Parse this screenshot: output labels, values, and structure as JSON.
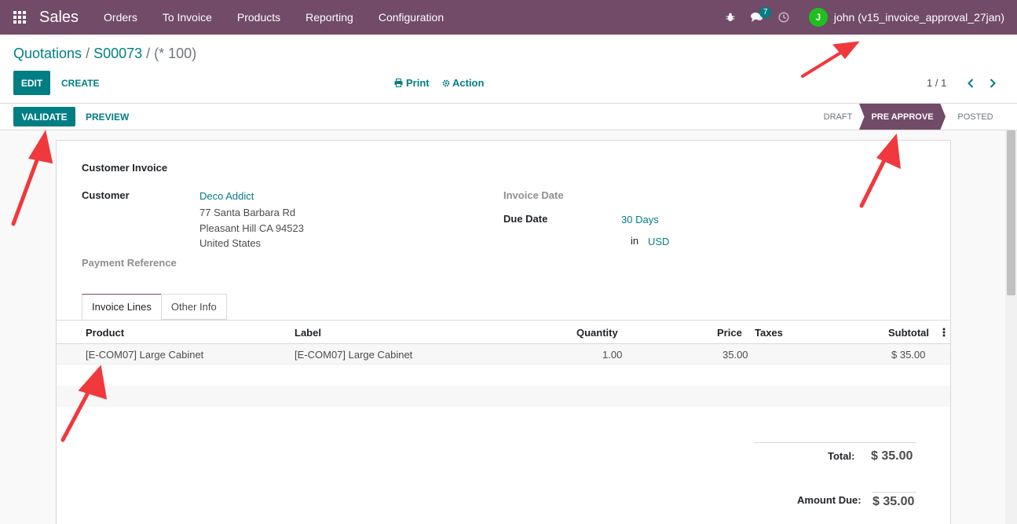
{
  "navbar": {
    "app_name": "Sales",
    "menu": [
      "Orders",
      "To Invoice",
      "Products",
      "Reporting",
      "Configuration"
    ],
    "messages_count": "7",
    "user_initial": "J",
    "user_name": "john (v15_invoice_approval_27jan)",
    "colors": {
      "bar": "#714b67",
      "avatar": "#1fbf1f"
    }
  },
  "breadcrumb": {
    "first": "Quotations",
    "sep1": " / ",
    "second": "S00073",
    "sep2": " / ",
    "current": "(* 100)"
  },
  "toolbar": {
    "edit_label": "EDIT",
    "create_label": "CREATE",
    "print_label": "Print",
    "action_label": "Action",
    "pager": "1 / 1"
  },
  "statusbar": {
    "validate_label": "VALIDATE",
    "preview_label": "PREVIEW",
    "stages": [
      "DRAFT",
      "PRE APPROVE",
      "POSTED"
    ],
    "active_stage": "PRE APPROVE"
  },
  "form": {
    "title": "Customer Invoice",
    "customer_label": "Customer",
    "customer_name": "Deco Addict",
    "address_line1": "77 Santa Barbara Rd",
    "address_line2": "Pleasant Hill CA 94523",
    "address_line3": "United States",
    "payment_reference_label": "Payment Reference",
    "invoice_date_label": "Invoice Date",
    "due_date_label": "Due Date",
    "due_date_value": "30 Days",
    "currency_in": "in",
    "currency": "USD"
  },
  "tabs": [
    "Invoice Lines",
    "Other Info"
  ],
  "lines": {
    "headers": [
      "Product",
      "Label",
      "Quantity",
      "Price",
      "Taxes",
      "Subtotal"
    ],
    "rows": [
      {
        "product": "[E-COM07] Large Cabinet",
        "label": "[E-COM07] Large Cabinet",
        "quantity": "1.00",
        "price": "35.00",
        "taxes": "",
        "subtotal": "$ 35.00"
      }
    ]
  },
  "totals": {
    "total_label": "Total:",
    "total_value": "$ 35.00",
    "amount_due_label": "Amount Due:",
    "amount_due_value": "$ 35.00"
  }
}
